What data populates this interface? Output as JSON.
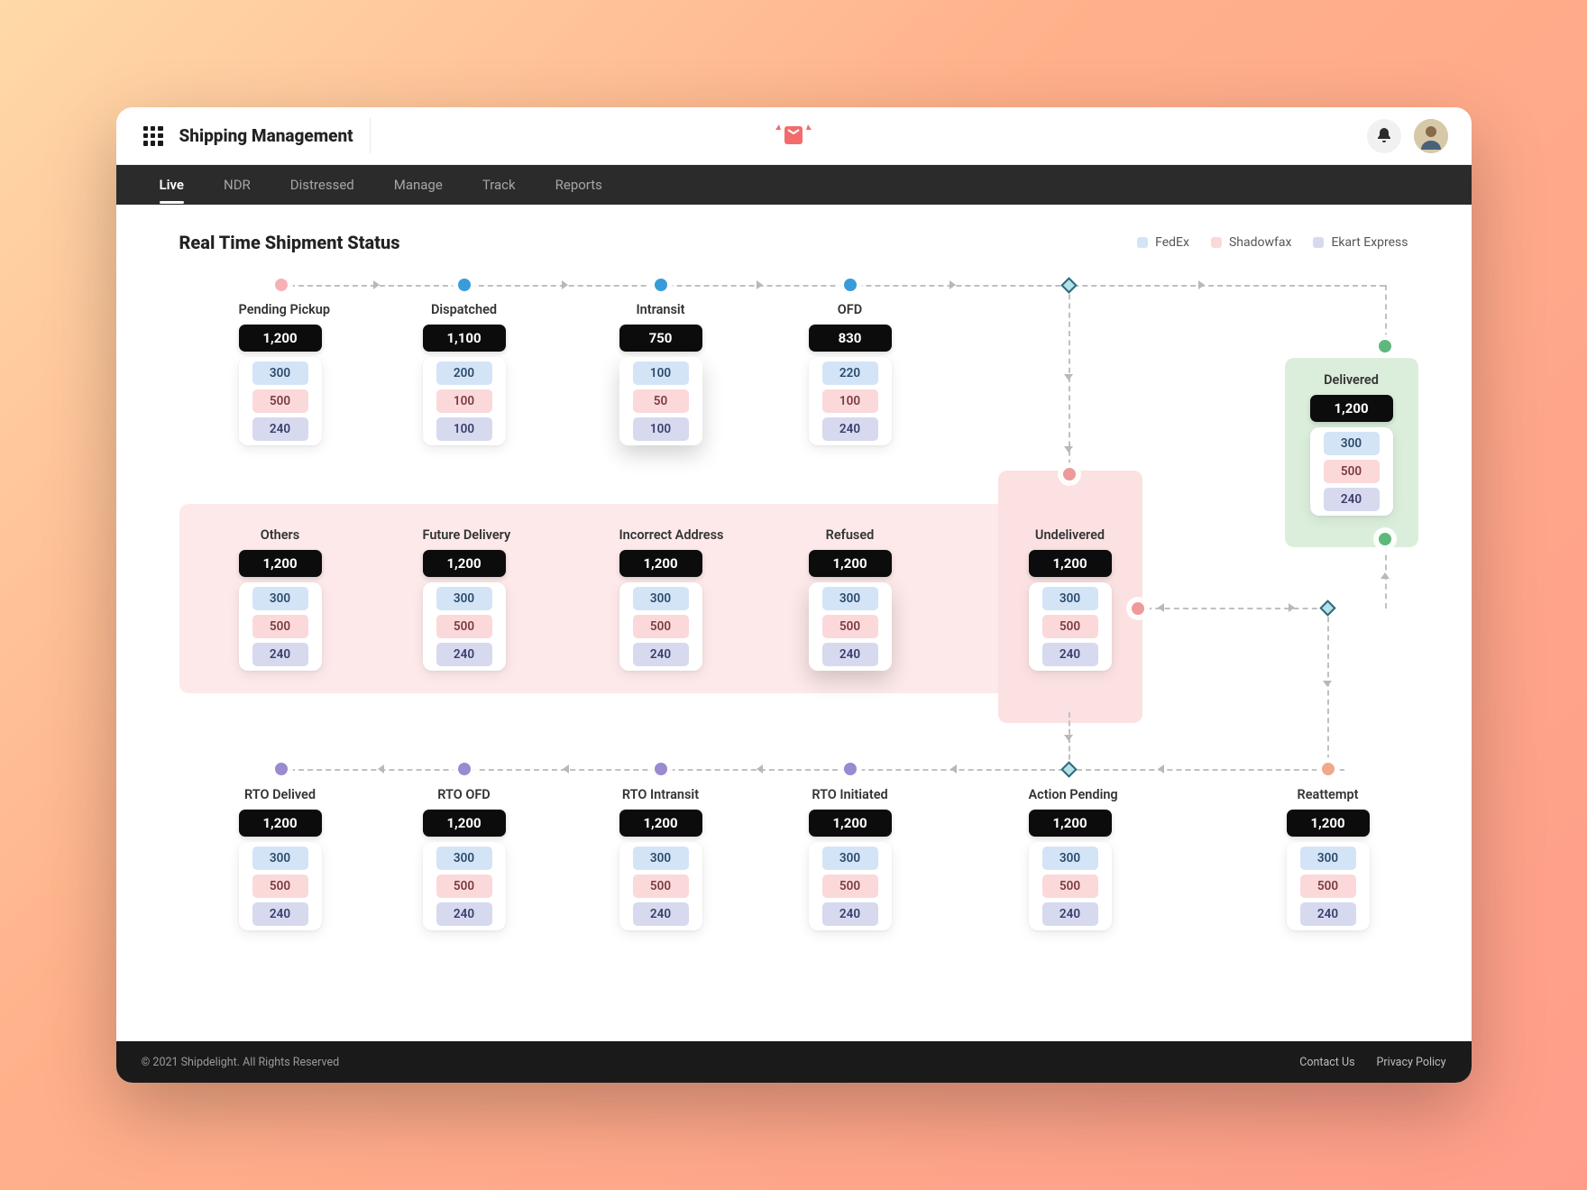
{
  "header": {
    "title": "Shipping Management"
  },
  "nav": {
    "items": [
      "Live",
      "NDR",
      "Distressed",
      "Manage",
      "Track",
      "Reports"
    ],
    "active": 0
  },
  "page": {
    "title": "Real Time Shipment Status"
  },
  "legend": [
    {
      "label": "FedEx",
      "color": "#d4e4f7"
    },
    {
      "label": "Shadowfax",
      "color": "#fbd9da"
    },
    {
      "label": "Ekart Express",
      "color": "#d7d9ef"
    }
  ],
  "stages": {
    "row1": [
      {
        "key": "pending_pickup",
        "label": "Pending Pickup",
        "total": "1,200",
        "fedex": "300",
        "shadowfax": "500",
        "ekart": "240"
      },
      {
        "key": "dispatched",
        "label": "Dispatched",
        "total": "1,100",
        "fedex": "200",
        "shadowfax": "100",
        "ekart": "100"
      },
      {
        "key": "intransit",
        "label": "Intransit",
        "total": "750",
        "fedex": "100",
        "shadowfax": "50",
        "ekart": "100"
      },
      {
        "key": "ofd",
        "label": "OFD",
        "total": "830",
        "fedex": "220",
        "shadowfax": "100",
        "ekart": "240"
      }
    ],
    "delivered": {
      "key": "delivered",
      "label": "Delivered",
      "total": "1,200",
      "fedex": "300",
      "shadowfax": "500",
      "ekart": "240"
    },
    "row2": [
      {
        "key": "others",
        "label": "Others",
        "total": "1,200",
        "fedex": "300",
        "shadowfax": "500",
        "ekart": "240"
      },
      {
        "key": "future_delivery",
        "label": "Future Delivery",
        "total": "1,200",
        "fedex": "300",
        "shadowfax": "500",
        "ekart": "240"
      },
      {
        "key": "incorrect_address",
        "label": "Incorrect Address",
        "total": "1,200",
        "fedex": "300",
        "shadowfax": "500",
        "ekart": "240"
      },
      {
        "key": "refused",
        "label": "Refused",
        "total": "1,200",
        "fedex": "300",
        "shadowfax": "500",
        "ekart": "240"
      },
      {
        "key": "undelivered",
        "label": "Undelivered",
        "total": "1,200",
        "fedex": "300",
        "shadowfax": "500",
        "ekart": "240"
      }
    ],
    "row3": [
      {
        "key": "rto_delivered",
        "label": "RTO Delived",
        "total": "1,200",
        "fedex": "300",
        "shadowfax": "500",
        "ekart": "240"
      },
      {
        "key": "rto_ofd",
        "label": "RTO OFD",
        "total": "1,200",
        "fedex": "300",
        "shadowfax": "500",
        "ekart": "240"
      },
      {
        "key": "rto_intransit",
        "label": "RTO Intransit",
        "total": "1,200",
        "fedex": "300",
        "shadowfax": "500",
        "ekart": "240"
      },
      {
        "key": "rto_initiated",
        "label": "RTO Initiated",
        "total": "1,200",
        "fedex": "300",
        "shadowfax": "500",
        "ekart": "240"
      },
      {
        "key": "action_pending",
        "label": "Action Pending",
        "total": "1,200",
        "fedex": "300",
        "shadowfax": "500",
        "ekart": "240"
      },
      {
        "key": "reattempt",
        "label": "Reattempt",
        "total": "1,200",
        "fedex": "300",
        "shadowfax": "500",
        "ekart": "240"
      }
    ]
  },
  "footer": {
    "copyright": "© 2021 Shipdelight. All Rights Reserved",
    "links": [
      "Contact Us",
      "Privacy Policy"
    ]
  }
}
